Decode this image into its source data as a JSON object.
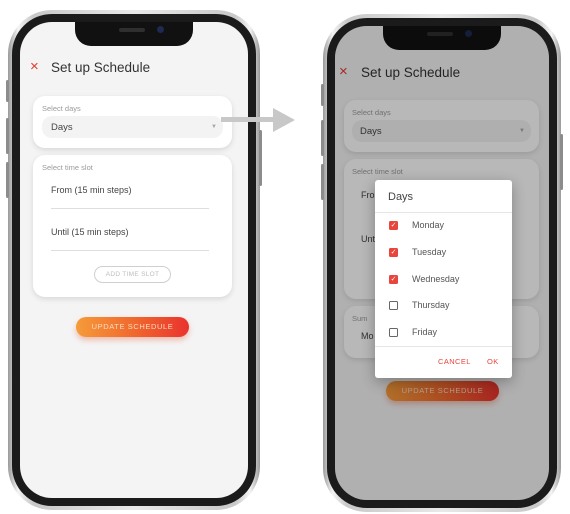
{
  "colors": {
    "accent": "#e8453c",
    "cta_start": "#f59b3a",
    "cta_end": "#e9332e",
    "screen_bg": "#f4f4f4"
  },
  "left_screen": {
    "close_icon": "×",
    "title": "Set up Schedule",
    "days_card": {
      "label": "Select days",
      "value": "Days",
      "caret_icon": "▼"
    },
    "time_card": {
      "label": "Select time slot",
      "from_field": "From (15 min steps)",
      "until_field": "Until (15 min steps)",
      "add_button": "ADD TIME SLOT"
    },
    "update_button": "UPDATE SCHEDULE"
  },
  "right_screen": {
    "close_icon": "×",
    "title": "Set up Schedule",
    "days_card": {
      "label": "Select days",
      "value": "Days",
      "caret_icon": "▼"
    },
    "time_card": {
      "label": "Select time slot",
      "partial_from": "Fro",
      "partial_until": "Unt"
    },
    "summary_card": {
      "partial_label": "Sum",
      "partial_value": "Mo"
    },
    "update_button": "UPDATE SCHEDULE",
    "dialog": {
      "title": "Days",
      "days": [
        {
          "label": "Monday",
          "checked": true
        },
        {
          "label": "Tuesday",
          "checked": true
        },
        {
          "label": "Wednesday",
          "checked": true
        },
        {
          "label": "Thursday",
          "checked": false
        },
        {
          "label": "Friday",
          "checked": false
        }
      ],
      "cancel_label": "CANCEL",
      "ok_label": "OK",
      "check_icon": "✓"
    }
  },
  "transition_arrow_icon": "arrow-right-icon"
}
